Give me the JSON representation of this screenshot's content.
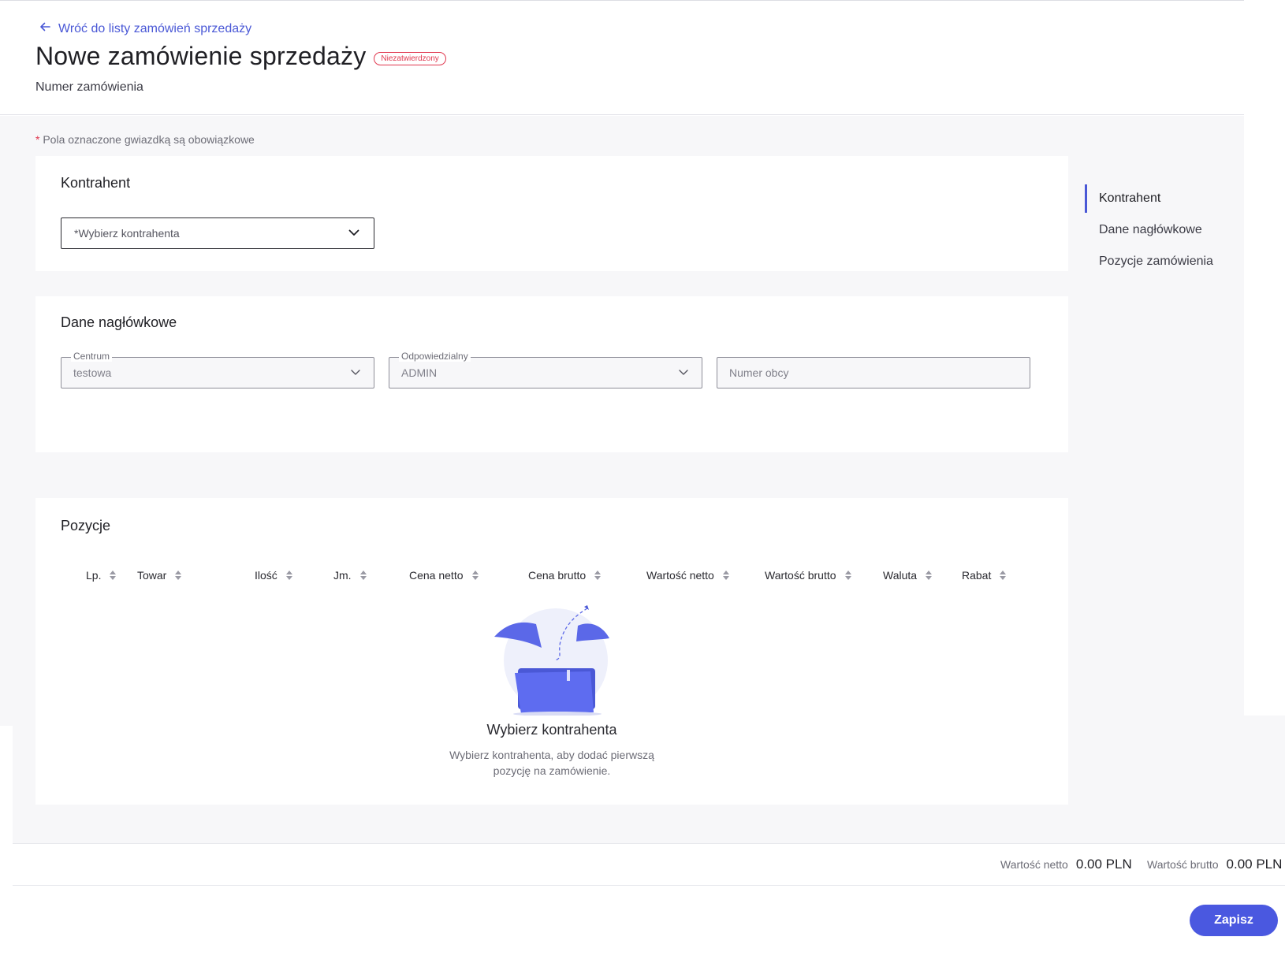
{
  "header": {
    "back_link": "Wróć do listy zamówień sprzedaży",
    "title": "Nowe zamówienie sprzedaży",
    "status_badge": "Niezatwierdzony",
    "order_number_label": "Numer zamówienia"
  },
  "form": {
    "required_note_star": "*",
    "required_note": "Pola oznaczone gwiazdką są obowiązkowe"
  },
  "contractor": {
    "title": "Kontrahent",
    "select_placeholder": "*Wybierz kontrahenta"
  },
  "header_data": {
    "title": "Dane nagłówkowe",
    "centrum_label": "Centrum",
    "centrum_value": "testowa",
    "responsible_label": "Odpowiedzialny",
    "responsible_value": "ADMIN",
    "foreign_number_placeholder": "Numer obcy"
  },
  "positions": {
    "title": "Pozycje",
    "columns": [
      "Lp.",
      "Towar",
      "Ilość",
      "Jm.",
      "Cena netto",
      "Cena brutto",
      "Wartość netto",
      "Wartość brutto",
      "Waluta",
      "Rabat"
    ],
    "empty_title": "Wybierz kontrahenta",
    "empty_desc": "Wybierz kontrahenta, aby dodać pierwszą pozycję na zamówienie."
  },
  "sidenav": {
    "items": [
      "Kontrahent",
      "Dane nagłówkowe",
      "Pozycje zamówienia"
    ],
    "active_index": 0
  },
  "summary": {
    "net_label": "Wartość netto",
    "net_value": "0.00 PLN",
    "gross_label": "Wartość brutto",
    "gross_value": "0.00 PLN"
  },
  "actions": {
    "save": "Zapisz"
  },
  "colors": {
    "accent": "#4a58d6",
    "status": "#e0384f",
    "background": "#f7f7f9"
  }
}
